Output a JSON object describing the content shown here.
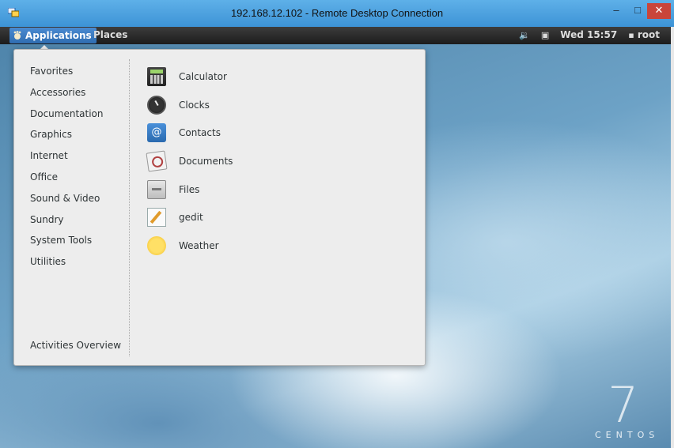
{
  "window": {
    "title": "192.168.12.102 - Remote Desktop Connection",
    "minimize": "–",
    "maximize": "□",
    "close": "✕"
  },
  "panel": {
    "applications_label": "Applications",
    "places_label": "Places",
    "datetime": "Wed 15:57",
    "user": "root"
  },
  "menu": {
    "categories": [
      "Favorites",
      "Accessories",
      "Documentation",
      "Graphics",
      "Internet",
      "Office",
      "Sound & Video",
      "Sundry",
      "System Tools",
      "Utilities"
    ],
    "activities_overview": "Activities Overview",
    "apps": [
      {
        "label": "Calculator",
        "icon": "calculator-icon"
      },
      {
        "label": "Clocks",
        "icon": "clock-icon"
      },
      {
        "label": "Contacts",
        "icon": "contacts-icon"
      },
      {
        "label": "Documents",
        "icon": "documents-icon"
      },
      {
        "label": "Files",
        "icon": "files-icon"
      },
      {
        "label": "gedit",
        "icon": "gedit-icon"
      },
      {
        "label": "Weather",
        "icon": "weather-icon"
      }
    ]
  },
  "desktop": {
    "logo_number": "7",
    "logo_text": "CENTOS"
  }
}
